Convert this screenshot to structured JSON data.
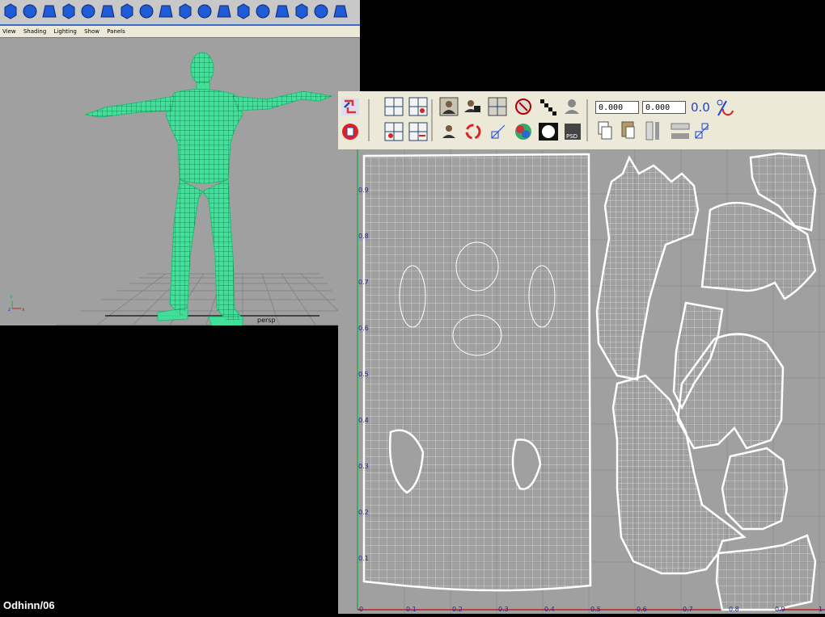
{
  "shelf": {
    "icons": [
      "sphere-icon",
      "cube-icon",
      "cylinder-icon",
      "cone-icon",
      "plane-icon",
      "torus-icon",
      "pipe-icon",
      "helix-icon",
      "soccer-ball-icon",
      "platonic-icon",
      "move-icon",
      "deform-icon",
      "lattice-icon",
      "extrude-icon",
      "split-icon",
      "bevel-icon",
      "merge-icon",
      "smooth-icon"
    ]
  },
  "viewport": {
    "menu": [
      "View",
      "Shading",
      "Lighting",
      "Show",
      "Panels"
    ],
    "camera_label": "persp",
    "axis_labels": [
      "y",
      "z",
      "x"
    ]
  },
  "uv_editor": {
    "field_u": "0.000",
    "field_v": "0.000",
    "tick_labels_x": [
      "0",
      "0.1",
      "0.2",
      "0.3",
      "0.4",
      "0.5",
      "0.6",
      "0.7",
      "0.8",
      "0.9",
      "1"
    ],
    "tick_labels_y": [
      "0.9",
      "0.8",
      "0.7",
      "0.6",
      "0.5",
      "0.4",
      "0.3",
      "0.2",
      "0.1"
    ],
    "colors": {
      "canvas": "#a0a0a0",
      "wire": "#ffffff",
      "accent": "#2a6fd6"
    }
  },
  "credit": "Odhinn/06"
}
